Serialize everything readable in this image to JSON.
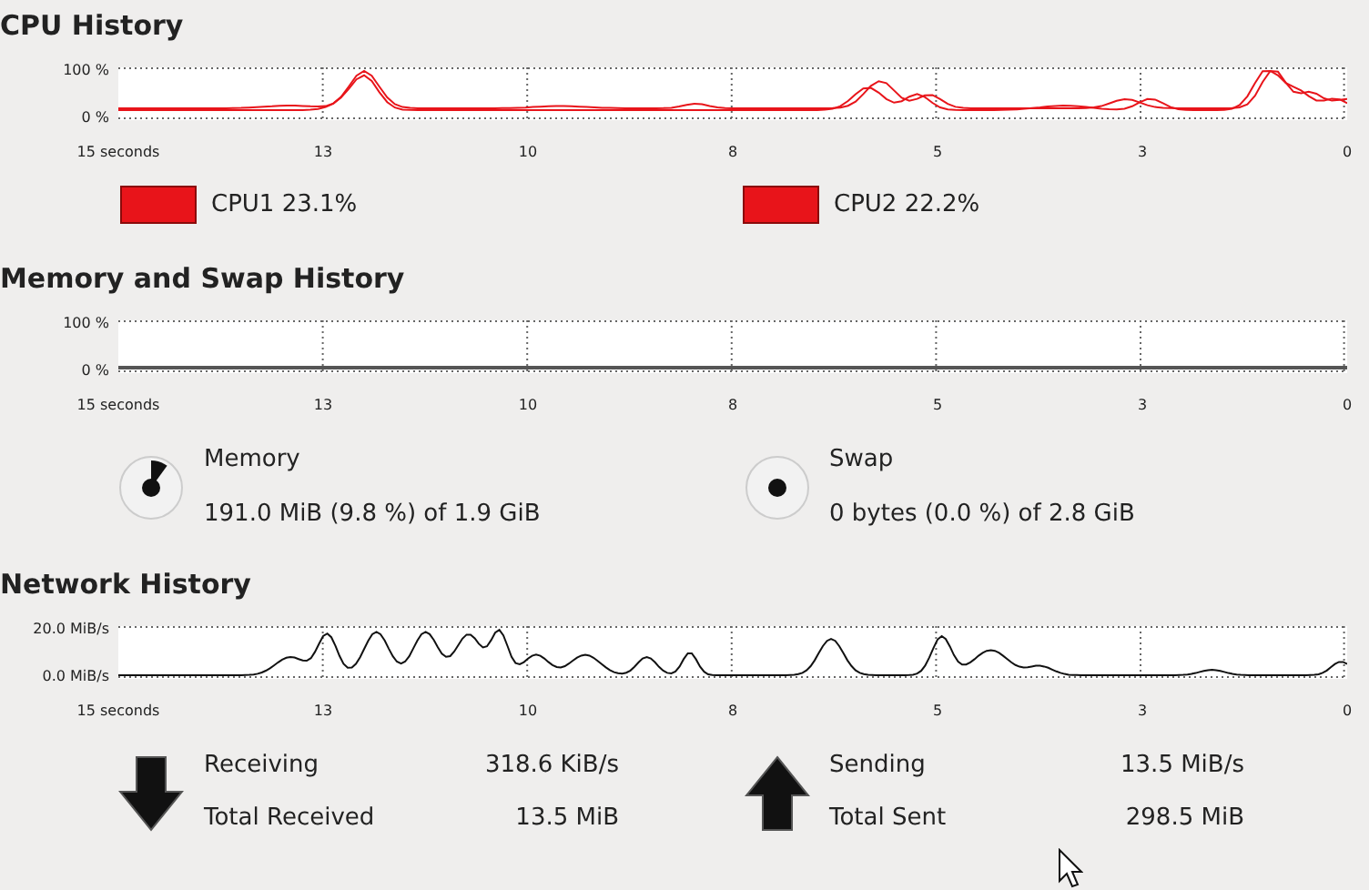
{
  "sections": [
    {
      "kind": "cpu",
      "title": "CPU History",
      "y_ticks": [
        "100 %",
        "0 %"
      ],
      "x_labels": [
        "15 seconds",
        "13",
        "10",
        "8",
        "5",
        "3",
        "0"
      ],
      "legend": [
        {
          "label": "CPU1 23.1%",
          "color": "#e8141a"
        },
        {
          "label": "CPU2 22.2%",
          "color": "#e8141a"
        }
      ]
    },
    {
      "kind": "memory",
      "title": "Memory and Swap History",
      "y_ticks": [
        "100 %",
        "0 %"
      ],
      "x_labels": [
        "15 seconds",
        "13",
        "10",
        "8",
        "5",
        "3",
        "0"
      ],
      "meters": [
        {
          "name": "Memory",
          "detail": "191.0 MiB (9.8 %) of 1.9 GiB",
          "kind": "memory"
        },
        {
          "name": "Swap",
          "detail": "0 bytes (0.0 %) of 2.8 GiB",
          "kind": "swap"
        }
      ]
    },
    {
      "kind": "network",
      "title": "Network History",
      "y_ticks": [
        "20.0 MiB/s",
        "0.0 MiB/s"
      ],
      "x_labels": [
        "15 seconds",
        "13",
        "10",
        "8",
        "5",
        "3",
        "0"
      ],
      "stats": [
        {
          "kind": "receive",
          "rows": [
            {
              "label": "Receiving",
              "value": "318.6 KiB/s"
            },
            {
              "label": "Total Received",
              "value": "13.5 MiB"
            }
          ]
        },
        {
          "kind": "send",
          "rows": [
            {
              "label": "Sending",
              "value": "13.5 MiB/s"
            },
            {
              "label": "Total Sent",
              "value": "298.5 MiB"
            }
          ]
        }
      ]
    }
  ]
}
